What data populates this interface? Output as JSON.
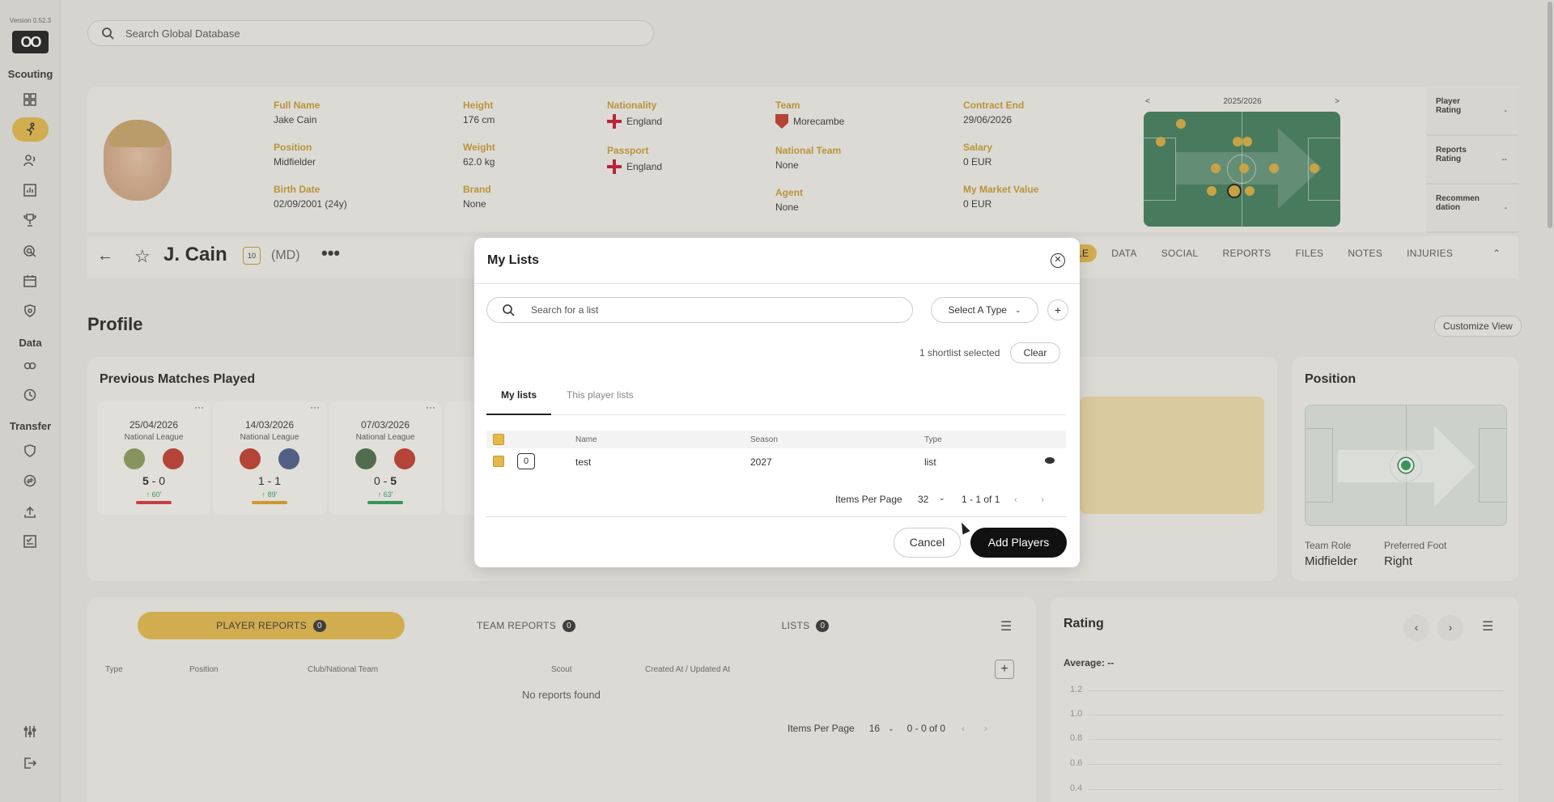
{
  "version": "Version 0.52.3",
  "logo_text": "OO",
  "sidebar": {
    "scouting_label": "Scouting",
    "data_label": "Data",
    "transfer_label": "Transfer",
    "icons": [
      "dashboard-icon",
      "player-icon",
      "scout-icon",
      "reports-icon",
      "trophy-icon",
      "target-icon",
      "calendar-icon",
      "shield-icon",
      "data-link-icon",
      "history-icon",
      "transfer-shield-icon",
      "exchange-icon",
      "upload-icon",
      "checklist-icon",
      "settings-sliders-icon",
      "logout-icon"
    ]
  },
  "global_search": {
    "placeholder": "Search Global Database"
  },
  "player": {
    "full_name_label": "Full Name",
    "full_name": "Jake Cain",
    "position_label": "Position",
    "position": "Midfielder",
    "birth_date_label": "Birth Date",
    "birth_date": "02/09/2001 (24y)",
    "height_label": "Height",
    "height": "176 cm",
    "weight_label": "Weight",
    "weight": "62.0 kg",
    "brand_label": "Brand",
    "brand": "None",
    "nationality_label": "Nationality",
    "nationality": "England",
    "passport_label": "Passport",
    "passport": "England",
    "team_label": "Team",
    "team": "Morecambe",
    "national_team_label": "National Team",
    "national_team": "None",
    "agent_label": "Agent",
    "agent": "None",
    "contract_end_label": "Contract End",
    "contract_end": "29/06/2026",
    "salary_label": "Salary",
    "salary": "0 EUR",
    "market_value_label": "My Market Value",
    "market_value": "0 EUR",
    "short_name": "J. Cain",
    "shirt_number": "10",
    "position_code": "(MD)"
  },
  "season": {
    "prev": "<",
    "label": "2025/2026",
    "next": ">"
  },
  "side_ratings": [
    {
      "label": "Player Rating",
      "value": "-"
    },
    {
      "label": "Reports Rating",
      "value": "--"
    },
    {
      "label": "Recommendation",
      "value": "-"
    }
  ],
  "tabs": [
    "LE",
    "DATA",
    "SOCIAL",
    "REPORTS",
    "FILES",
    "NOTES",
    "INJURIES"
  ],
  "profile_title": "Profile",
  "customize_label": "Customize View",
  "previous_matches": {
    "title": "Previous Matches Played",
    "matches": [
      {
        "date": "25/04/2026",
        "league": "National League",
        "home": "5",
        "away": "0",
        "minute": "↑ 60'",
        "bar_color": "#d9303a"
      },
      {
        "date": "14/03/2026",
        "league": "National League",
        "home": "1",
        "away": "1",
        "minute": "↑ 89'",
        "bar_color": "#e0a020"
      },
      {
        "date": "07/03/2026",
        "league": "National League",
        "home": "0",
        "away": "5",
        "minute": "↑ 63'",
        "bar_color": "#2a9a55"
      }
    ]
  },
  "position_card": {
    "title": "Position",
    "team_role_label": "Team Role",
    "team_role": "Midfielder",
    "preferred_foot_label": "Preferred Foot",
    "preferred_foot": "Right"
  },
  "reports": {
    "tabs": [
      {
        "label": "PLAYER REPORTS",
        "count": "0"
      },
      {
        "label": "TEAM REPORTS",
        "count": "0"
      },
      {
        "label": "LISTS",
        "count": "0"
      }
    ],
    "columns": [
      "Type",
      "Position",
      "Club/National Team",
      "Scout",
      "Created At / Updated At"
    ],
    "empty": "No reports found",
    "items_per_page_label": "Items Per Page",
    "items_per_page": "16",
    "range": "0 - 0 of 0"
  },
  "rating_card": {
    "title": "Rating",
    "average": "Average: --",
    "ticks": [
      "1.2",
      "1.0",
      "0.8",
      "0.6",
      "0.4"
    ]
  },
  "modal": {
    "title": "My Lists",
    "search_placeholder": "Search for a list",
    "select_type": "Select A Type",
    "selected_text": "1 shortlist selected",
    "clear_label": "Clear",
    "tabs": [
      "My lists",
      "This player lists"
    ],
    "columns": {
      "name": "Name",
      "season": "Season",
      "type": "Type"
    },
    "rows": [
      {
        "count": "0",
        "name": "test",
        "season": "2027",
        "type": "list"
      }
    ],
    "items_per_page_label": "Items Per Page",
    "items_per_page": "32",
    "range": "1 - 1 of 1",
    "cancel_label": "Cancel",
    "add_players_label": "Add Players"
  }
}
